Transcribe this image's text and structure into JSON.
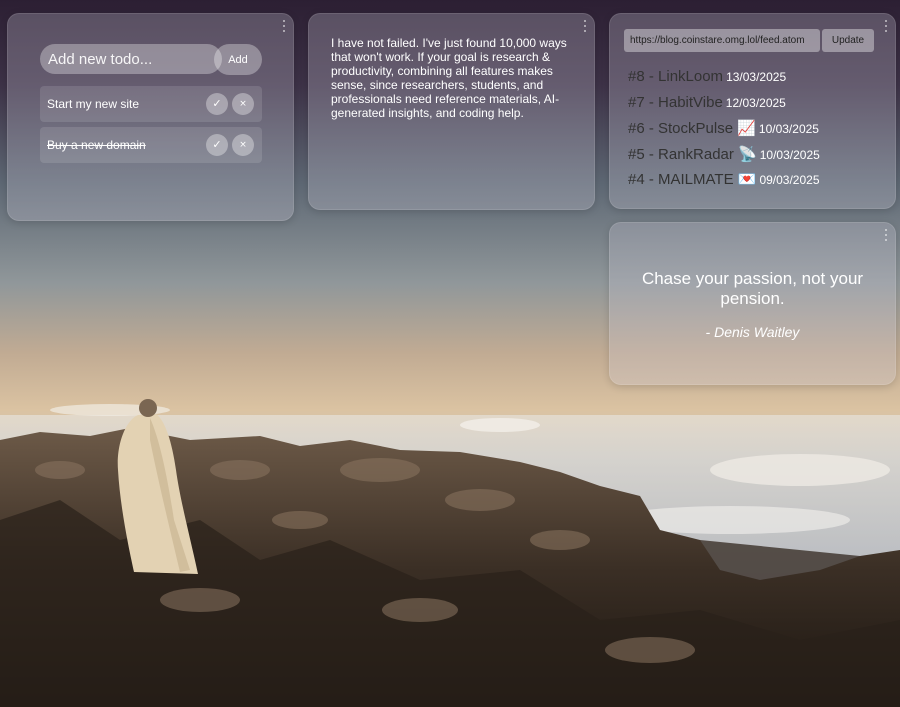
{
  "todo": {
    "input_placeholder": "Add new todo...",
    "add_label": "Add",
    "items": [
      {
        "text": "Start my new site",
        "done": false
      },
      {
        "text": "Buy a new domain",
        "done": true
      }
    ],
    "check_glyph": "✓",
    "delete_glyph": "×"
  },
  "notes": {
    "text": "I have not failed. I've just found 10,000 ways that won't work. If your goal is research & productivity, combining all features makes sense, since researchers, students, and professionals need reference materials, AI-generated insights, and coding help."
  },
  "feed": {
    "url_value": "https://blog.coinstare.omg.lol/feed.atom",
    "update_label": "Update",
    "items": [
      {
        "title": "#8 - LinkLoom",
        "date": "13/03/2025"
      },
      {
        "title": "#7 - HabitVibe",
        "date": "12/03/2025"
      },
      {
        "title": "#6 - StockPulse 📈",
        "date": "10/03/2025"
      },
      {
        "title": "#5 - RankRadar 📡",
        "date": "10/03/2025"
      },
      {
        "title": "#4 - MAILMATE 💌",
        "date": "09/03/2025"
      }
    ]
  },
  "quote": {
    "text": "Chase your passion, not your pension.",
    "author": "- Denis Waitley"
  },
  "icons": {
    "menu": "more-vertical-icon",
    "check": "check-icon",
    "delete": "close-icon"
  },
  "colors": {
    "widget_glass": "#cdc8d7",
    "feed_title_text": "#333333",
    "text": "#ffffff"
  }
}
